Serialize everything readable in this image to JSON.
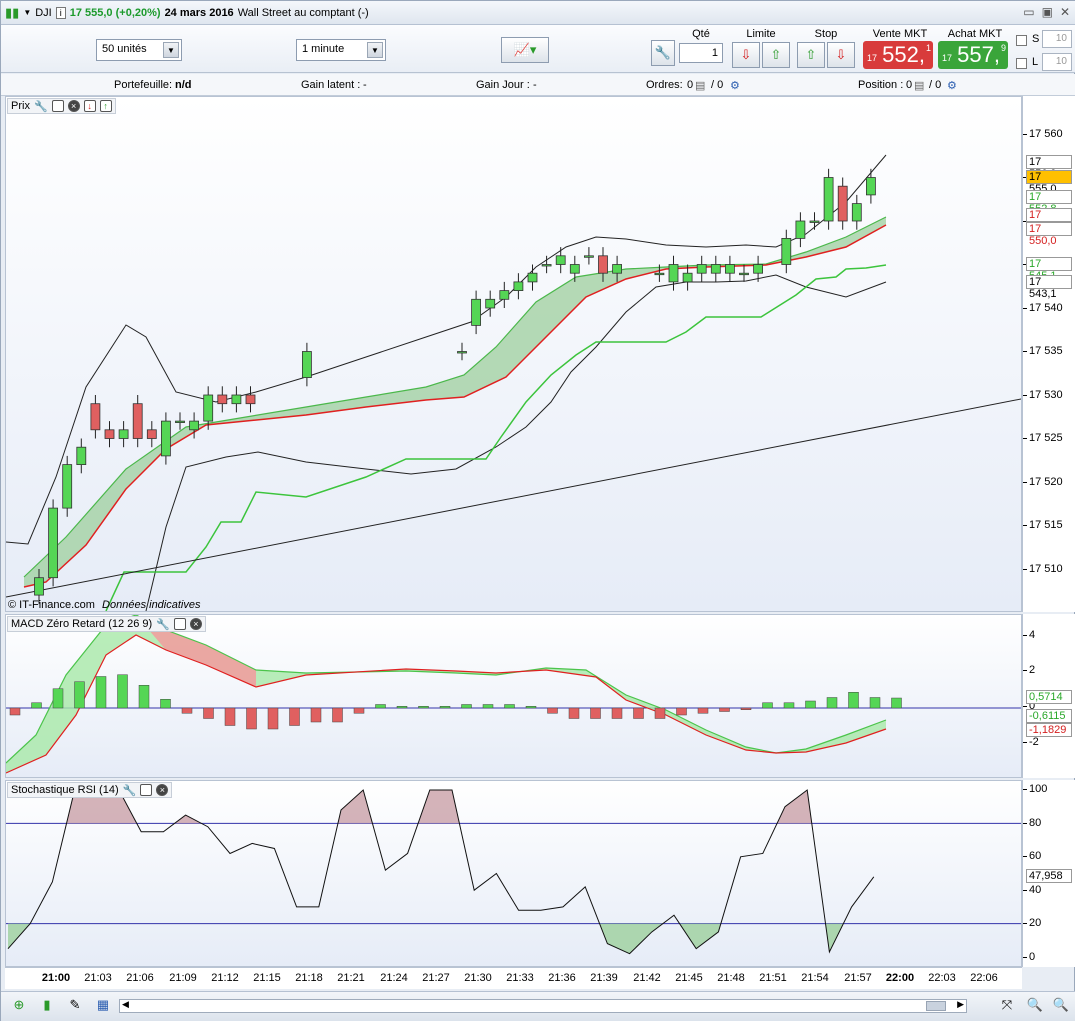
{
  "window": {
    "symbol": "DJI",
    "price_change": "17 555,0 (+0,20%)",
    "date": "24 mars 2016",
    "market": "Wall Street au comptant (-)",
    "info_icon": "i"
  },
  "toolbar": {
    "units": "50 unités",
    "interval": "1 minute",
    "qty_label": "Qté",
    "qty_value": "1",
    "limit_label": "Limite",
    "stop_label": "Stop",
    "sell_label": "Vente MKT",
    "buy_label": "Achat MKT",
    "sell_small": "17",
    "sell_big": "552,",
    "sell_sup": "1",
    "buy_small": "17",
    "buy_big": "557,",
    "buy_sup": "9",
    "s_label": "S",
    "l_label": "L",
    "s_value": "10",
    "l_value": "10"
  },
  "infobar": {
    "portfolio_label": "Portefeuille:",
    "portfolio_value": "n/d",
    "latent_label": "Gain latent :",
    "latent_value": "-",
    "day_label": "Gain Jour :",
    "day_value": "-",
    "orders_label": "Ordres:",
    "orders_a": "0",
    "orders_b": "/ 0",
    "position_label": "Position :",
    "position_a": "0",
    "position_b": "/ 0"
  },
  "panels": {
    "price_title": "Prix",
    "watermark_site": "© IT-Finance.com",
    "watermark_note": "Données indicatives",
    "macd_title": "MACD Zéro Retard (12 26 9)",
    "stoch_title": "Stochastique RSI (14)"
  },
  "price_axis": {
    "ticks": [
      "17 560",
      "17 555",
      "17 550",
      "17 545",
      "17 540",
      "17 535",
      "17 530",
      "17 525",
      "17 520",
      "17 515",
      "17 510"
    ],
    "tags": [
      {
        "text": "17 556,9",
        "bg": "#ffffff",
        "fg": "#000000"
      },
      {
        "text": "17 555,0",
        "bg": "#ffc000",
        "fg": "#000000"
      },
      {
        "text": "17 552,8",
        "bg": "#ffffff",
        "fg": "#2aa82a"
      },
      {
        "text": "17 550,0",
        "bg": "#ffffff",
        "fg": "#d42020"
      },
      {
        "text": "17 550,0",
        "bg": "#ffffff",
        "fg": "#d42020"
      },
      {
        "text": "17 545,1",
        "bg": "#ffffff",
        "fg": "#2aa82a"
      },
      {
        "text": "17 543,1",
        "bg": "#ffffff",
        "fg": "#000000"
      }
    ]
  },
  "macd_axis": {
    "ticks": [
      "4",
      "2",
      "0",
      "-2"
    ],
    "tags": [
      {
        "text": "0,5714",
        "bg": "#ffffff",
        "fg": "#2aa82a"
      },
      {
        "text": "-0,6115",
        "bg": "#ffffff",
        "fg": "#2aa82a"
      },
      {
        "text": "-1,1829",
        "bg": "#ffffff",
        "fg": "#d42020"
      }
    ]
  },
  "stoch_axis": {
    "ticks": [
      "100",
      "80",
      "60",
      "40",
      "20",
      "0"
    ],
    "tags": [
      {
        "text": "47,958",
        "bg": "#ffffff",
        "fg": "#000000"
      }
    ]
  },
  "time_axis": [
    "21:00",
    "21:03",
    "21:06",
    "21:09",
    "21:12",
    "21:15",
    "21:18",
    "21:21",
    "21:24",
    "21:27",
    "21:30",
    "21:33",
    "21:36",
    "21:39",
    "21:42",
    "21:45",
    "21:48",
    "21:51",
    "21:54",
    "21:57",
    "22:00",
    "22:03",
    "22:06"
  ],
  "chart_data": [
    {
      "type": "candlestick",
      "title": "Prix",
      "x": [
        "20:59",
        "21:00",
        "21:01",
        "21:02",
        "21:03",
        "21:04",
        "21:05",
        "21:06",
        "21:07",
        "21:08",
        "21:09",
        "21:10",
        "21:11",
        "21:12",
        "21:13",
        "21:14",
        "21:18",
        "21:29",
        "21:30",
        "21:31",
        "21:32",
        "21:33",
        "21:34",
        "21:35",
        "21:36",
        "21:37",
        "21:38",
        "21:39",
        "21:40",
        "21:43",
        "21:44",
        "21:45",
        "21:46",
        "21:47",
        "21:48",
        "21:49",
        "21:50",
        "21:52",
        "21:53",
        "21:54",
        "21:55",
        "21:56",
        "21:57",
        "21:58"
      ],
      "open": [
        17507,
        17509,
        17517,
        17522,
        17529,
        17526,
        17525,
        17529,
        17526,
        17523,
        17527,
        17526,
        17527,
        17530,
        17529,
        17530,
        17532,
        17535,
        17538,
        17540,
        17541,
        17542,
        17543,
        17545,
        17545,
        17544,
        17546,
        17546,
        17544,
        17544,
        17543,
        17543,
        17544,
        17544,
        17544,
        17544,
        17544,
        17545,
        17548,
        17550,
        17550,
        17554,
        17550,
        17553
      ],
      "close": [
        17509,
        17517,
        17522,
        17524,
        17526,
        17525,
        17526,
        17525,
        17525,
        17527,
        17527,
        17527,
        17530,
        17529,
        17530,
        17529,
        17535,
        17535,
        17541,
        17541,
        17542,
        17543,
        17544,
        17545,
        17546,
        17545,
        17546,
        17544,
        17545,
        17544,
        17545,
        17544,
        17545,
        17545,
        17545,
        17544,
        17545,
        17548,
        17550,
        17550,
        17555,
        17550,
        17552,
        17555
      ],
      "ylim": [
        17505,
        17563
      ]
    },
    {
      "type": "line",
      "title": "MACD Zéro Retard (12 26 9)",
      "ylim": [
        -3,
        5
      ],
      "histogram": [
        -0.4,
        0.3,
        1.1,
        1.5,
        1.8,
        1.9,
        1.3,
        0.5,
        -0.3,
        -0.6,
        -1.0,
        -1.2,
        -1.2,
        -1.0,
        -0.8,
        -0.8,
        -0.3,
        0.2,
        0.1,
        0.1,
        0.1,
        0.2,
        0.2,
        0.2,
        0.1,
        -0.3,
        -0.6,
        -0.6,
        -0.6,
        -0.6,
        -0.6,
        -0.4,
        -0.3,
        -0.2,
        -0.1,
        0.3,
        0.3,
        0.4,
        0.6,
        0.9,
        0.6,
        0.57
      ]
    },
    {
      "type": "line",
      "title": "Stochastique RSI (14)",
      "ylim": [
        0,
        100
      ],
      "values": [
        5,
        20,
        45,
        100,
        100,
        100,
        75,
        75,
        85,
        78,
        62,
        68,
        65,
        30,
        30,
        88,
        100,
        52,
        62,
        100,
        100,
        40,
        50,
        28,
        28,
        30,
        42,
        8,
        2,
        15,
        25,
        5,
        15,
        60,
        62,
        90,
        100,
        3,
        30,
        48
      ]
    }
  ]
}
